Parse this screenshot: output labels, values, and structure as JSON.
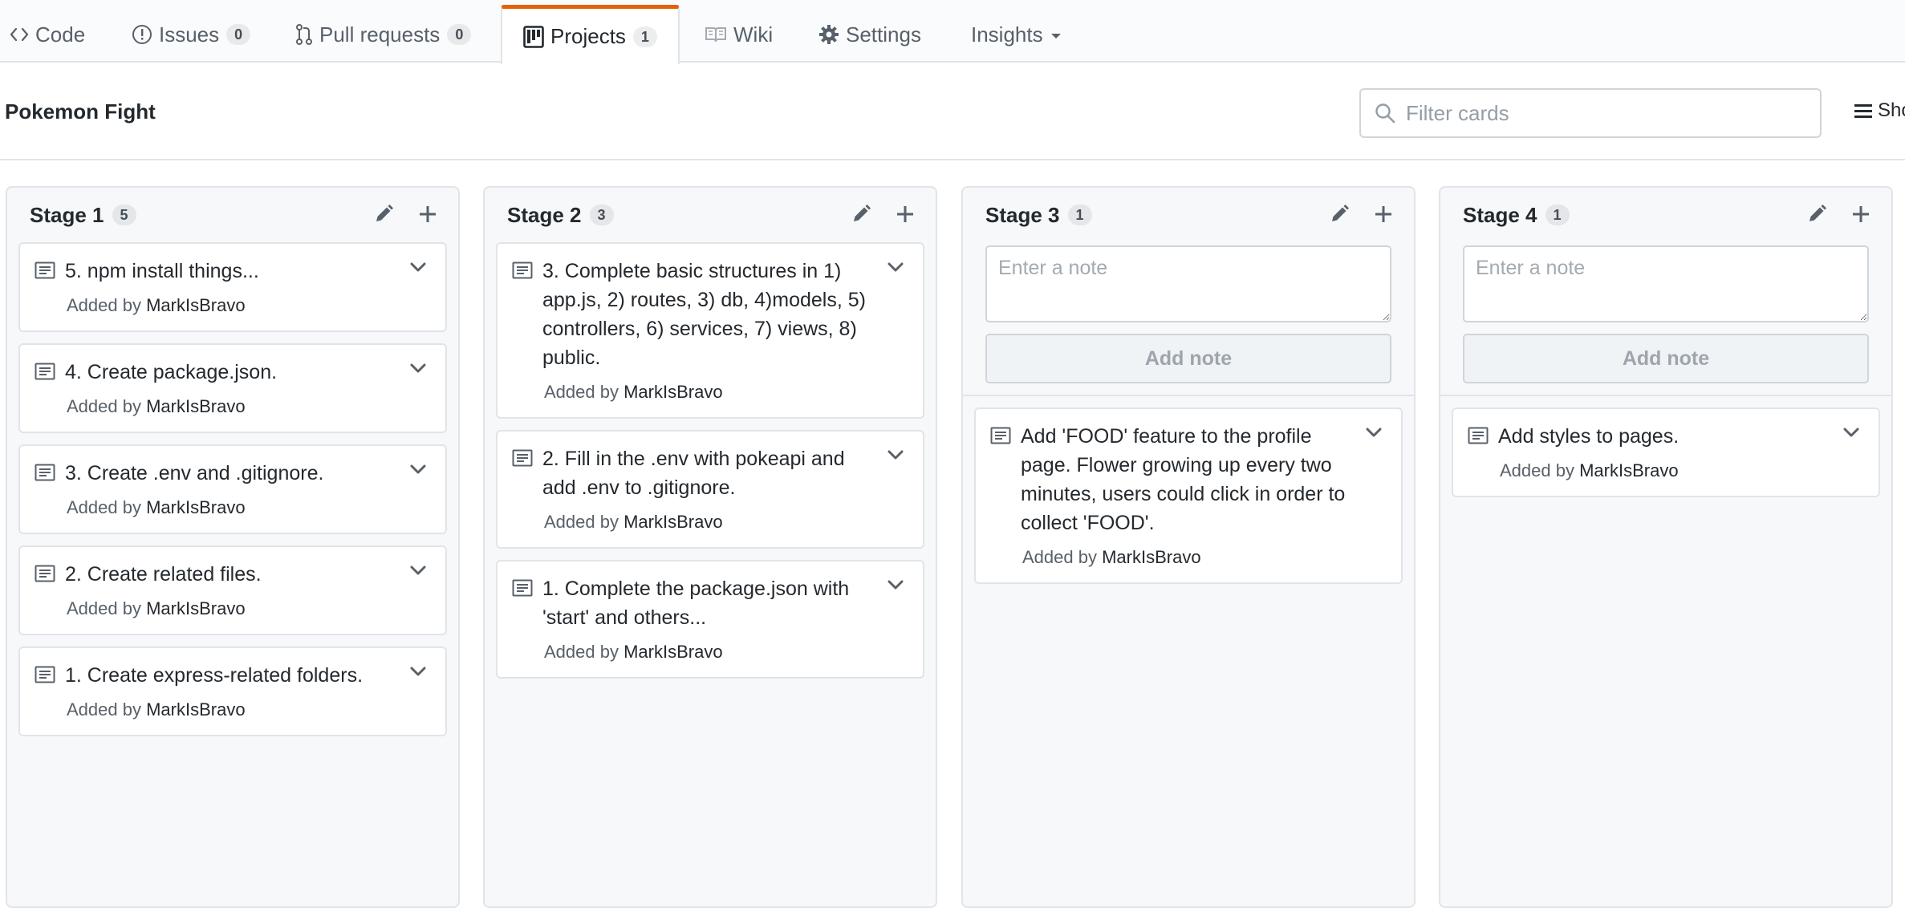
{
  "repo_nav": {
    "tabs": [
      {
        "label": "Code",
        "icon": "code-icon"
      },
      {
        "label": "Issues",
        "count": "0",
        "icon": "issue-icon"
      },
      {
        "label": "Pull requests",
        "count": "0",
        "icon": "pull-request-icon"
      },
      {
        "label": "Projects",
        "count": "1",
        "icon": "project-icon",
        "selected": true
      },
      {
        "label": "Wiki",
        "icon": "book-icon"
      },
      {
        "label": "Settings",
        "icon": "gear-icon"
      },
      {
        "label": "Insights",
        "icon": "caret-down-icon"
      }
    ],
    "accent_color": "#e36209"
  },
  "project": {
    "title": "Pokemon Fight",
    "filter_placeholder": "Filter cards",
    "menu_label": "Sho"
  },
  "columns": [
    {
      "name": "Stage 1",
      "count": "5",
      "cards": [
        {
          "text": "5. npm install things...",
          "added_by": "Added by",
          "user": "MarkIsBravo"
        },
        {
          "text": "4. Create package.json.",
          "added_by": "Added by",
          "user": "MarkIsBravo"
        },
        {
          "text": "3. Create .env and .gitignore.",
          "added_by": "Added by",
          "user": "MarkIsBravo"
        },
        {
          "text": "2. Create related files.",
          "added_by": "Added by",
          "user": "MarkIsBravo"
        },
        {
          "text": "1. Create express-related folders.",
          "added_by": "Added by",
          "user": "MarkIsBravo"
        }
      ]
    },
    {
      "name": "Stage 2",
      "count": "3",
      "cards": [
        {
          "text": "3. Complete basic structures in 1) app.js, 2) routes, 3) db, 4)models, 5) controllers, 6) services, 7) views, 8) public.",
          "added_by": "Added by",
          "user": "MarkIsBravo"
        },
        {
          "text": "2. Fill in the .env with pokeapi and add .env to .gitignore.",
          "added_by": "Added by",
          "user": "MarkIsBravo"
        },
        {
          "text": "1. Complete the package.json with 'start' and others...",
          "added_by": "Added by",
          "user": "MarkIsBravo"
        }
      ]
    },
    {
      "name": "Stage 3",
      "count": "1",
      "note_placeholder": "Enter a note",
      "add_note_label": "Add note",
      "cards": [
        {
          "text": "Add 'FOOD' feature to the profile page. Flower growing up every two minutes, users could click in order to collect 'FOOD'.",
          "added_by": "Added by",
          "user": "MarkIsBravo"
        }
      ]
    },
    {
      "name": "Stage 4",
      "count": "1",
      "note_placeholder": "Enter a note",
      "add_note_label": "Add note",
      "cards": [
        {
          "text": "Add styles to pages.",
          "added_by": "Added by",
          "user": "MarkIsBravo"
        }
      ]
    }
  ]
}
